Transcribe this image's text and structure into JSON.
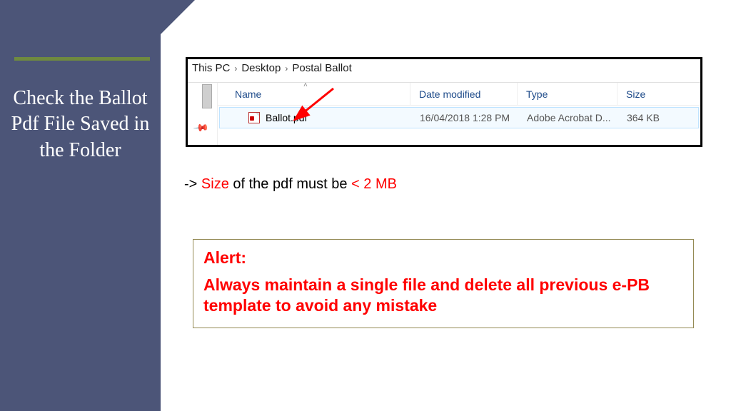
{
  "sidebar": {
    "title": "Check the Ballot Pdf File Saved in the Folder"
  },
  "explorer": {
    "breadcrumb": [
      "This PC",
      "Desktop",
      "Postal Ballot"
    ],
    "columns": {
      "name": "Name",
      "date": "Date modified",
      "type": "Type",
      "size": "Size"
    },
    "file": {
      "name": "Ballot.pdf",
      "date": "16/04/2018 1:28 PM",
      "type": "Adobe Acrobat D...",
      "size": "364 KB"
    }
  },
  "note": {
    "prefix": "-> ",
    "size_word": "Size",
    "mid": " of the pdf must be ",
    "limit": "< 2 MB"
  },
  "alert": {
    "title": "Alert:",
    "text": "Always maintain a single file and delete all previous e-PB template to avoid any mistake"
  }
}
